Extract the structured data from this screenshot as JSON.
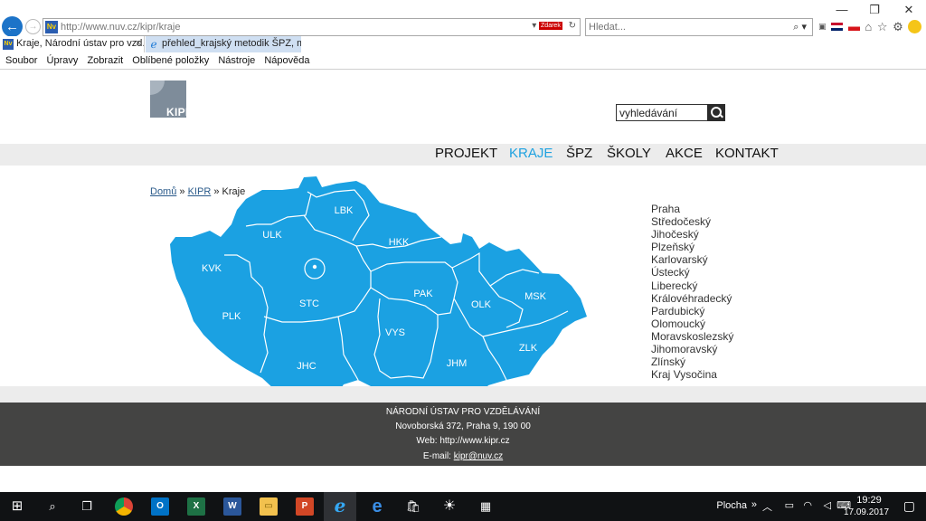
{
  "browser": {
    "window_controls": [
      "—",
      "❐",
      "✕"
    ],
    "url": "http://www.nuv.cz/kipr/kraje",
    "search_placeholder": "Hledat...",
    "zdarek_label": "Zdarek",
    "tabs": [
      {
        "label": "Kraje, Národní ústav pro vzd...",
        "close": "×"
      },
      {
        "label": "přehled_krajský metodik ŠPZ, m..."
      }
    ],
    "menu": [
      "Soubor",
      "Úpravy",
      "Zobrazit",
      "Oblíbené položky",
      "Nástroje",
      "Nápověda"
    ]
  },
  "site": {
    "logo_text": "KIPR",
    "search_value": "vyhledávání",
    "nav": [
      "PROJEKT",
      "KRAJE",
      "ŠPZ",
      "ŠKOLY",
      "AKCE",
      "KONTAKT"
    ],
    "nav_active": "KRAJE",
    "accent_color": "#1fa2e0",
    "map_color": "#1ba1e2",
    "breadcrumb": {
      "home": "Domů",
      "sep": "»",
      "kipr": "KIPR",
      "current": "Kraje"
    },
    "map_labels": [
      "LBK",
      "ULK",
      "HKK",
      "KVK",
      "STC",
      "PAK",
      "OLK",
      "MSK",
      "PLK",
      "VYS",
      "ZLK",
      "JHC",
      "JHM"
    ],
    "regions": [
      "Praha",
      "Středočeský",
      "Jihočeský",
      "Plzeňský",
      "Karlovarský",
      "Ústecký",
      "Liberecký",
      "Královéhradecký",
      "Pardubický",
      "Olomoucký",
      "Moravskoslezský",
      "Jihomoravský",
      "Zlínský",
      "Kraj Vysočina"
    ],
    "footer": {
      "org": "NÁRODNÍ ÚSTAV PRO VZDĚLÁVÁNÍ",
      "address": "Novoborská 372, Praha 9, 190 00",
      "web": "Web: http://www.kipr.cz",
      "email_label": "E-mail:",
      "email": "kipr@nuv.cz"
    }
  },
  "taskbar": {
    "plocha": "Plocha",
    "time": "19:29",
    "date": "17.09.2017"
  }
}
